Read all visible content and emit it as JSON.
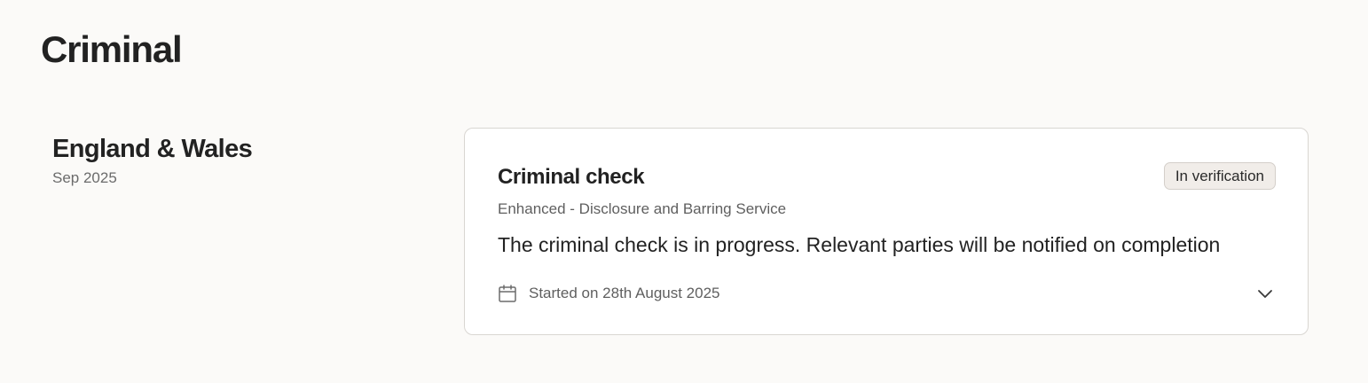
{
  "page": {
    "title": "Criminal"
  },
  "region": {
    "name": "England & Wales",
    "date": "Sep 2025"
  },
  "check": {
    "title": "Criminal check",
    "status": "In verification",
    "subtitle": "Enhanced - Disclosure and Barring Service",
    "description": "The criminal check is in progress. Relevant parties will be notified on completion",
    "started": "Started on 28th August 2025",
    "icons": {
      "date": "calendar-icon",
      "expand": "chevron-down-icon"
    }
  },
  "colors": {
    "background": "#fbfaf8",
    "card": "#ffffff",
    "border": "#d9d6d2",
    "badge_background": "#f1ede9",
    "text": "#222222",
    "muted_text": "#5f5f5f"
  }
}
